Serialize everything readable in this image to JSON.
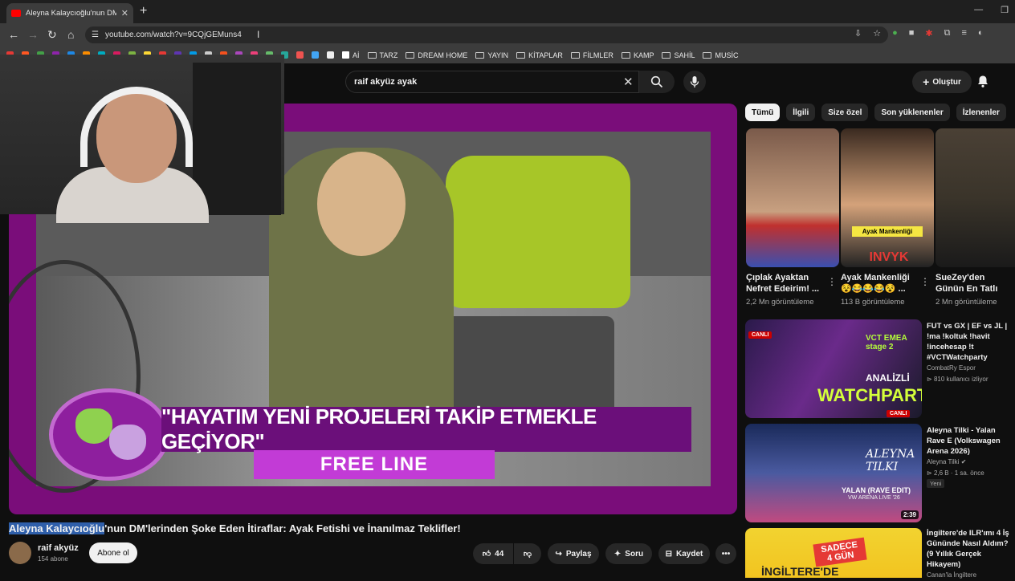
{
  "browser": {
    "tab_title": "Aleyna Kalaycıoğlu'nun DM'lerind",
    "url": "youtube.com/watch?v=9CQjGEMuns4",
    "bookmarks": [
      "Aİ",
      "TARZ",
      "DREAM HOME",
      "YAYIN",
      "KİTAPLAR",
      "FİLMLER",
      "KAMP",
      "SAHİL",
      "MUSİC"
    ]
  },
  "youtube": {
    "search_query": "raif akyüz ayak",
    "create_label": "Oluştur"
  },
  "video": {
    "banner_text": "\"HAYATIM YENİ PROJELERİ TAKİP ETMEKLE GEÇİYOR\"",
    "show_name": "FREE LINE",
    "title_highlight": "Aleyna Kalaycıoğlu",
    "title_rest": "'nun DM'lerinden Şoke Eden İtiraflar: Ayak Fetishi ve İnanılmaz Teklifler!",
    "channel_name": "raif akyüz",
    "subscribers": "154 abone",
    "subscribe_label": "Abone ol",
    "likes": "44",
    "share_label": "Paylaş",
    "ask_label": "Soru",
    "save_label": "Kaydet"
  },
  "chips": [
    "Tümü",
    "İlgili",
    "Size özel",
    "Son yüklenenler",
    "İzlenenler"
  ],
  "shorts": [
    {
      "title": "Çıplak Ayaktan Nefret Edeirim! ...",
      "views": "2,2 Mn görüntüleme"
    },
    {
      "title": "Ayak Mankenliği 😵😂😂😂😵 ...",
      "views": "113 B görüntüleme",
      "overlay": "Ayak Mankenliği",
      "overlay2": "INVYK"
    },
    {
      "title": "SueZey'den Günün En Tatlı Videosu!...",
      "views": "2 Mn görüntüleme"
    }
  ],
  "related": [
    {
      "title": "FUT vs GX | EF vs JL | !ma !koltuk !havit !incehesap !t #VCTWatchparty",
      "channel": "CombatRy Espor",
      "meta": "810 kullanıcı izliyor",
      "badge": "CANLI",
      "thumb_text": "WATCHPARTY",
      "thumb_sub": "ANALİZLİ",
      "thumb_logo": "VCT EMEA stage 2"
    },
    {
      "title": "Aleyna Tilki - Yalan Rave E (Volkswagen Arena 2026)",
      "channel": "Aleyna Tilki",
      "meta": "2,6 B · 1 sa. önce",
      "badge": "Yeni",
      "duration": "2:39",
      "thumb_text": "YALAN (RAVE EDIT)",
      "thumb_sub": "VW ARENA LIVE '26",
      "thumb_logo": "ALEYNA TILKI"
    },
    {
      "title": "İngiltere'de ILR'ımı 4 İş Gününde Nasıl Aldım? (9 Yıllık Gerçek Hikayem)",
      "channel": "Canan'la İngiltere",
      "thumb_text": "SADECE 4 GÜN",
      "thumb_sub": "İNGİLTERE'DE"
    }
  ]
}
